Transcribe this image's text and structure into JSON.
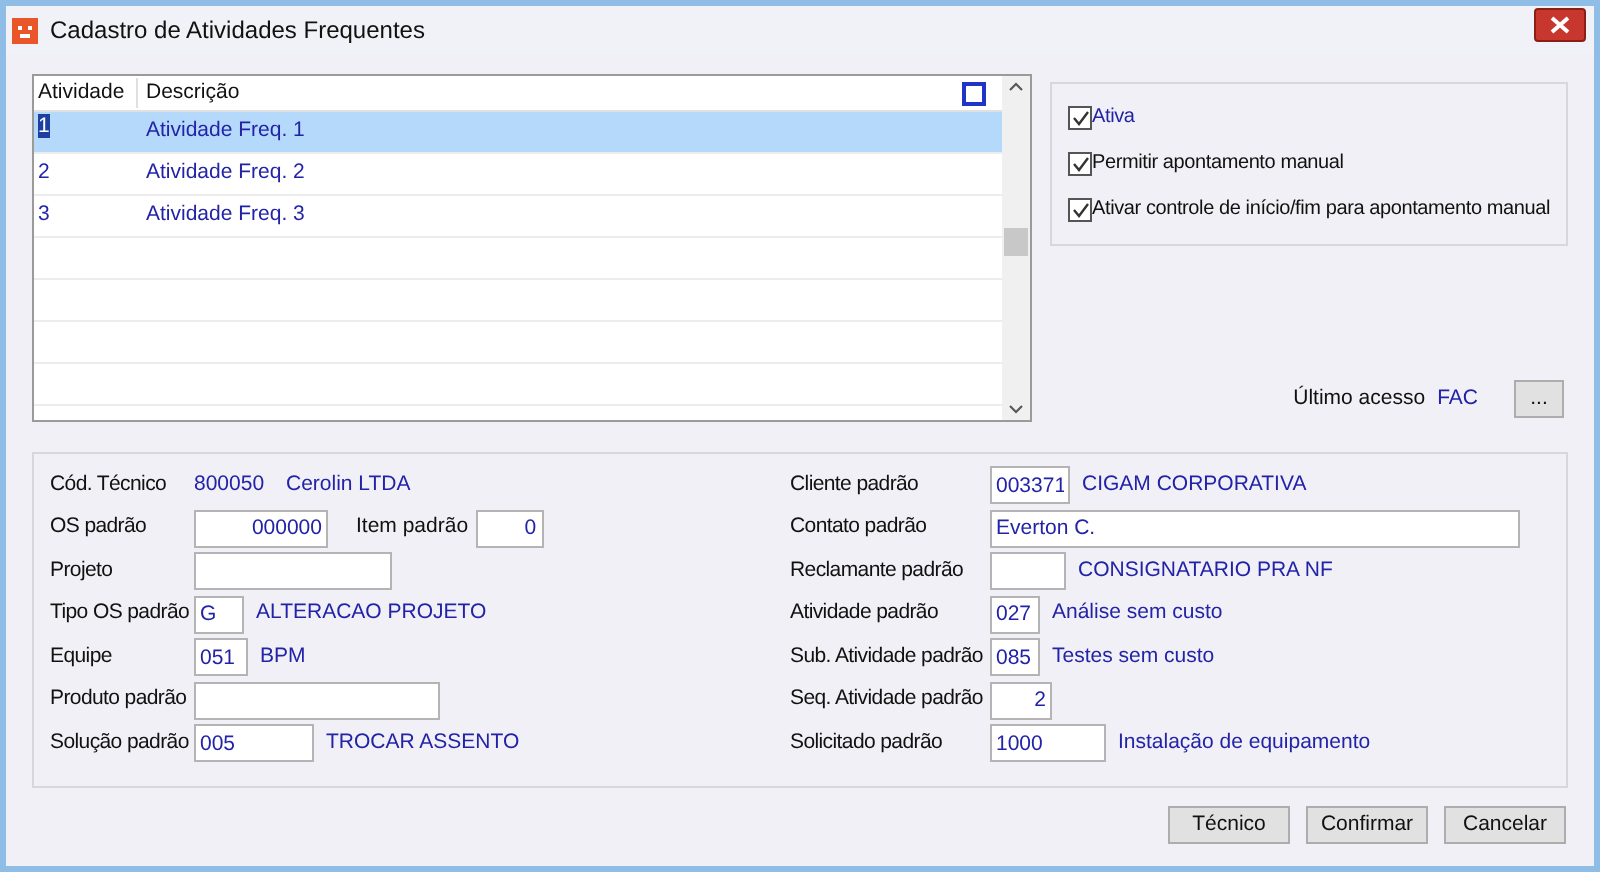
{
  "window": {
    "title": "Cadastro de Atividades Frequentes"
  },
  "table": {
    "columns": [
      "Atividade",
      "Descrição"
    ],
    "select_all": {
      "checked": false
    },
    "rows": [
      {
        "atividade": "1",
        "descricao": "Atividade Freq. 1",
        "selected": true
      },
      {
        "atividade": "2",
        "descricao": "Atividade Freq. 2",
        "selected": false
      },
      {
        "atividade": "3",
        "descricao": "Atividade Freq. 3",
        "selected": false
      }
    ]
  },
  "options": [
    {
      "label": "Ativa",
      "checked": true
    },
    {
      "label": "Permitir apontamento manual",
      "checked": true
    },
    {
      "label": "Ativar controle de início/fim para apontamento manual",
      "checked": true
    }
  ],
  "last_access": {
    "label": "Último acesso",
    "value": "FAC",
    "button": "..."
  },
  "left_fields": [
    {
      "kind": "display",
      "label": "Cód. Técnico",
      "value": "800050",
      "description": "Cerolin LTDA"
    },
    {
      "kind": "number_input",
      "label": "OS padrão",
      "value": "000000",
      "extra": {
        "label": "Item padrão",
        "value": "0"
      }
    },
    {
      "kind": "input",
      "label": "Projeto"
    },
    {
      "kind": "input",
      "label": "Tipo OS padrão",
      "value": "G",
      "description": "ALTERACAO PROJETO"
    },
    {
      "kind": "input",
      "label": "Equipe",
      "value": "051",
      "description": "BPM"
    },
    {
      "kind": "input",
      "label": "Produto padrão"
    },
    {
      "kind": "input",
      "label": "Solução padrão",
      "value": "005",
      "description": "TROCAR ASSENTO"
    }
  ],
  "right_fields": [
    {
      "kind": "input",
      "label": "Cliente padrão",
      "value": "003371",
      "description": "CIGAM CORPORATIVA"
    },
    {
      "kind": "input",
      "label": "Contato padrão",
      "value": "Everton C."
    },
    {
      "kind": "input",
      "label": "Reclamante padrão",
      "description": "CONSIGNATARIO PRA NF"
    },
    {
      "kind": "input",
      "label": "Atividade padrão",
      "value": "027",
      "description": "Análise sem custo"
    },
    {
      "kind": "input",
      "label": "Sub. Atividade padrão",
      "value": "085",
      "description": "Testes sem custo"
    },
    {
      "kind": "number_input",
      "label": "Seq. Atividade padrão",
      "value": "2"
    },
    {
      "kind": "input",
      "label": "Solicitado padrão",
      "value": "1000",
      "description": "Instalação de equipamento"
    }
  ],
  "buttons": [
    "Técnico",
    "Confirmar",
    "Cancelar"
  ]
}
